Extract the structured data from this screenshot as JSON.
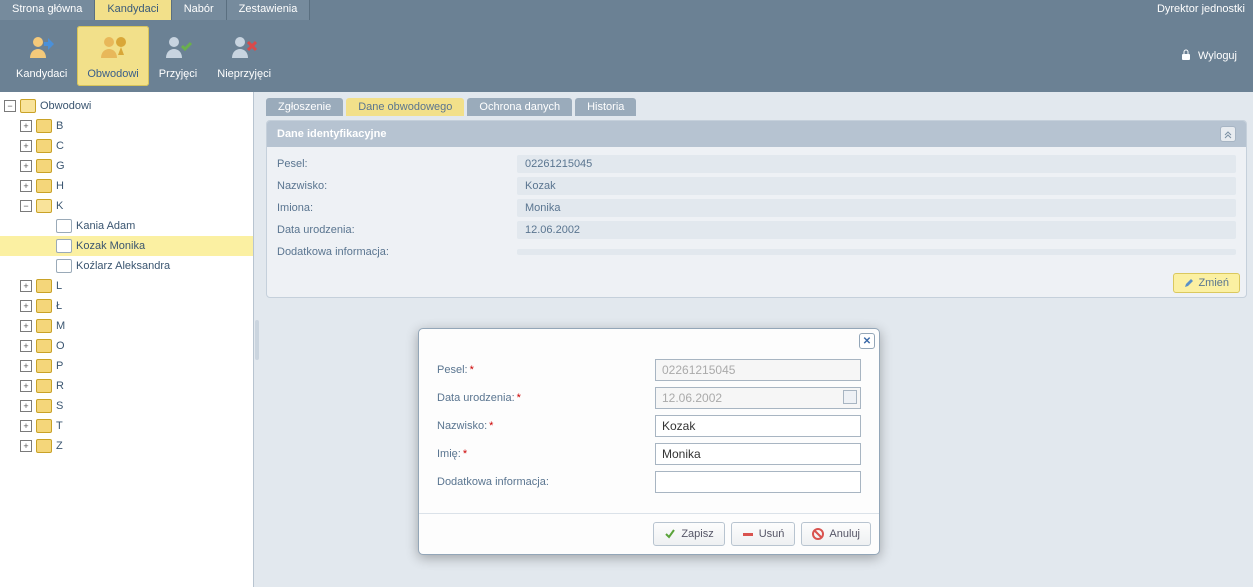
{
  "top_tabs": [
    "Strona główna",
    "Kandydaci",
    "Nabór",
    "Zestawienia"
  ],
  "top_tab_active": 1,
  "user_role": "Dyrektor jednostki",
  "logout_label": "Wyloguj",
  "toolbar": [
    {
      "label": "Kandydaci"
    },
    {
      "label": "Obwodowi"
    },
    {
      "label": "Przyjęci"
    },
    {
      "label": "Nieprzyjęci"
    }
  ],
  "toolbar_active": 1,
  "tree": {
    "root": "Obwodowi",
    "folders": [
      "B",
      "C",
      "G",
      "H",
      "K",
      "L",
      "Ł",
      "M",
      "O",
      "P",
      "R",
      "S",
      "T",
      "Z"
    ],
    "expanded": "K",
    "children": [
      "Kania Adam",
      "Kozak Monika",
      "Koźlarz Aleksandra"
    ],
    "selected_child": 1
  },
  "inner_tabs": [
    "Zgłoszenie",
    "Dane obwodowego",
    "Ochrona danych",
    "Historia"
  ],
  "inner_tab_active": 1,
  "panel_title": "Dane identyfikacyjne",
  "details": {
    "pesel_label": "Pesel:",
    "pesel_value": "02261215045",
    "nazwisko_label": "Nazwisko:",
    "nazwisko_value": "Kozak",
    "imiona_label": "Imiona:",
    "imiona_value": "Monika",
    "data_ur_label": "Data urodzenia:",
    "data_ur_value": "12.06.2002",
    "dodatkowa_label": "Dodatkowa informacja:",
    "dodatkowa_value": ""
  },
  "zmien_label": "Zmień",
  "modal": {
    "pesel_label": "Pesel:",
    "pesel_value": "02261215045",
    "data_ur_label": "Data urodzenia:",
    "data_ur_value": "12.06.2002",
    "nazwisko_label": "Nazwisko:",
    "nazwisko_value": "Kozak",
    "imie_label": "Imię:",
    "imie_value": "Monika",
    "dodatkowa_label": "Dodatkowa informacja:",
    "dodatkowa_value": "",
    "zapisz": "Zapisz",
    "usun": "Usuń",
    "anuluj": "Anuluj"
  }
}
